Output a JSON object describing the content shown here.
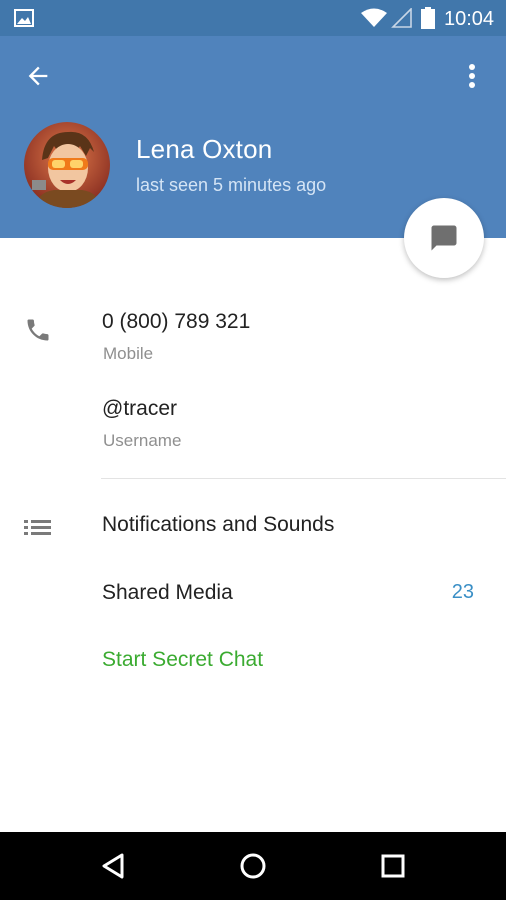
{
  "status_bar": {
    "time": "10:04",
    "icons": [
      "gallery-icon",
      "wifi-icon",
      "signal-icon",
      "battery-icon"
    ]
  },
  "header": {
    "name": "Lena Oxton",
    "last_seen": "last seen 5 minutes ago",
    "back_icon": "arrow-back-icon",
    "menu_icon": "more-vert-icon"
  },
  "fab": {
    "icon": "message-icon"
  },
  "contact": {
    "phone": "0 (800) 789 321",
    "phone_label": "Mobile",
    "username": "@tracer",
    "username_label": "Username"
  },
  "menu": {
    "notifications": "Notifications and Sounds",
    "shared_media": "Shared Media",
    "shared_media_count": "23",
    "secret_chat": "Start Secret Chat"
  },
  "nav": {
    "icons": [
      "back-triangle-icon",
      "home-circle-icon",
      "recents-square-icon"
    ]
  },
  "colors": {
    "status_bar": "#4177ab",
    "header": "#5083bc",
    "accent_blue": "#3a8fc6",
    "secret_green": "#3bab31"
  }
}
